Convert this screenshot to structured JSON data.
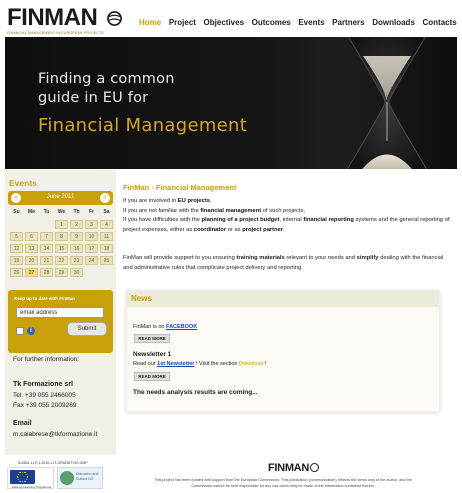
{
  "header": {
    "logo_wordmark": "FINMAN",
    "logo_tagline": "FINANCIAL MANAGEMENT IN EUROPEAN PROJECTS",
    "nav": [
      {
        "label": "Home",
        "active": true
      },
      {
        "label": "Project",
        "active": false
      },
      {
        "label": "Objectives",
        "active": false
      },
      {
        "label": "Outcomes",
        "active": false
      },
      {
        "label": "Events",
        "active": false
      },
      {
        "label": "Partners",
        "active": false
      },
      {
        "label": "Downloads",
        "active": false
      },
      {
        "label": "Contacts",
        "active": false
      }
    ]
  },
  "hero": {
    "line1": "Finding a common",
    "line2": "guide in EU for",
    "line3": "Financial Management"
  },
  "sidebar": {
    "events_title": "Events",
    "calendar": {
      "month_label": "June 2011",
      "prev_label": "‹",
      "next_label": "›",
      "day_names": [
        "Su",
        "Mo",
        "Tu",
        "We",
        "Th",
        "Fr",
        "Sa"
      ],
      "first_weekday": 3,
      "days_in_month": 30,
      "today": 27
    },
    "newsletter": {
      "title": "Keep up to date with FinMan",
      "email_placeholder": "email address",
      "submit_label": "Submit",
      "info_icon": "i"
    },
    "further_info": "For further information:",
    "org_name": "Tk Formazione srl",
    "tel": "Tel. +39 055 2466005",
    "fax": "Fax +39 055 2009269",
    "email_heading": "Email",
    "email_value": "m.calabrese@tkformazione.it"
  },
  "main": {
    "title": "FinMan - Financial Management",
    "intro_lines": [
      {
        "pre": "If you are involved in ",
        "bold": "EU projects",
        "post": ","
      },
      {
        "pre": "If you are not familiar with the ",
        "bold": "financial management",
        "post": " of such projects,"
      }
    ],
    "intro3_pre": "If you have difficulties with the ",
    "intro3_b1": "planning of a project budget",
    "intro3_mid1": ", internal ",
    "intro3_b2": "financial reporting",
    "intro3_mid2": " systems and the general reporting of project expenses, either as ",
    "intro3_b3": "coordinator",
    "intro3_mid3": " or as ",
    "intro3_b4": "project partner",
    "intro3_end": ".",
    "p2_pre": "FinMan will provide support to you ensuring ",
    "p2_b1": "training materials",
    "p2_mid": " relevant to your needs and ",
    "p2_b2": "simplify",
    "p2_end": " dealing with the financial and administrative rules that complicate project delivery and reporting.",
    "news": {
      "heading": "News",
      "item1_pre": "FinMan is on ",
      "item1_link": "FACEBOOK",
      "read_more": "READ MORE",
      "item2_title": "Newsletter 1",
      "item2_pre": "Read our ",
      "item2_link": "1st Newsletter",
      "item2_mid": " ! Visit the section ",
      "item2_dl": "Download",
      "item2_end": " !",
      "item3_title": "The needs analysis results are coming..."
    }
  },
  "footer": {
    "code": "510601-LLP-1-2010-1-IT-GRUNDTVIG-GMP",
    "eu_caption": "Lifelong Learning Programme",
    "llp_text": "Education and Culture DG",
    "logo": "FINMAN",
    "disclaimer_1": "This project has been funded with support from the European Commission. This publication (communication) reflects the views only of the author, and the",
    "disclaimer_2": "Commission cannot be held responsible for any use which may be made of the information contained therein."
  }
}
